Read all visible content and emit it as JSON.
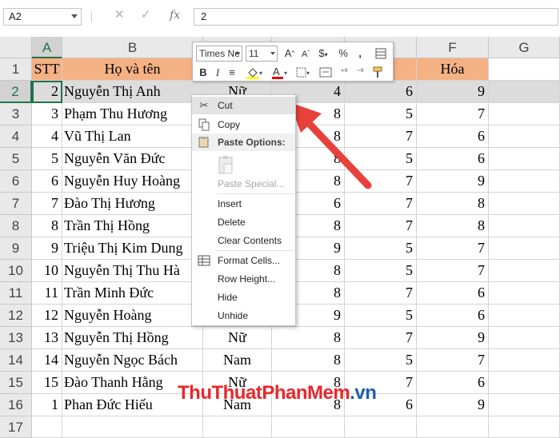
{
  "formula_bar": {
    "name_box": "A2",
    "cancel_icon": "close-icon",
    "confirm_icon": "check-icon",
    "fx_label": "fx",
    "formula_value": "2"
  },
  "columns": [
    "A",
    "B",
    "C",
    "D",
    "E",
    "F",
    "G"
  ],
  "rows": [
    "1",
    "2",
    "3",
    "4",
    "5",
    "6",
    "7",
    "8",
    "9",
    "10",
    "11",
    "12",
    "13",
    "14",
    "15",
    "16",
    "17"
  ],
  "header_row": {
    "a": "STT",
    "b": "Họ và tên",
    "f": "Hóa"
  },
  "data_rows": [
    {
      "a": "2",
      "b": "Nguyễn Thị Anh",
      "c": "Nữ",
      "d": "4",
      "e": "6",
      "f": "9"
    },
    {
      "a": "3",
      "b": "Phạm Thu Hương",
      "c": "",
      "d": "8",
      "e": "5",
      "f": "7"
    },
    {
      "a": "4",
      "b": "Vũ Thị Lan",
      "c": "",
      "d": "8",
      "e": "7",
      "f": "6"
    },
    {
      "a": "5",
      "b": "Nguyễn Văn Đức",
      "c": "",
      "d": "8",
      "e": "5",
      "f": "6"
    },
    {
      "a": "6",
      "b": "Nguyễn Huy Hoàng",
      "c": "",
      "d": "8",
      "e": "7",
      "f": "9"
    },
    {
      "a": "7",
      "b": "Đào Thị Hương",
      "c": "",
      "d": "6",
      "e": "7",
      "f": "8"
    },
    {
      "a": "8",
      "b": "Trần Thị Hồng",
      "c": "",
      "d": "8",
      "e": "7",
      "f": "8"
    },
    {
      "a": "9",
      "b": "Triệu Thị Kim Dung",
      "c": "",
      "d": "9",
      "e": "5",
      "f": "7"
    },
    {
      "a": "10",
      "b": "Nguyễn Thị Thu Hà",
      "c": "",
      "d": "8",
      "e": "5",
      "f": "7"
    },
    {
      "a": "11",
      "b": "Trần Minh Đức",
      "c": "",
      "d": "8",
      "e": "7",
      "f": "6"
    },
    {
      "a": "12",
      "b": "Nguyễn Hoàng",
      "c": "",
      "d": "9",
      "e": "5",
      "f": "6"
    },
    {
      "a": "13",
      "b": "Nguyễn Thị Hồng",
      "c": "Nữ",
      "d": "8",
      "e": "7",
      "f": "9"
    },
    {
      "a": "14",
      "b": "Nguyễn Ngọc Bách",
      "c": "Nam",
      "d": "8",
      "e": "5",
      "f": "7"
    },
    {
      "a": "15",
      "b": "Đào Thanh Hằng",
      "c": "Nữ",
      "d": "8",
      "e": "7",
      "f": "6"
    },
    {
      "a": "1",
      "b": "Phan Đức Hiếu",
      "c": "Nam",
      "d": "8",
      "e": "6",
      "f": "9"
    }
  ],
  "mini_toolbar": {
    "font_name": "Times Ne",
    "font_size": "11",
    "bold": "B",
    "italic": "I",
    "currency": "$",
    "percent": "%",
    "comma": ","
  },
  "context_menu": {
    "items": [
      {
        "label": "Cut",
        "icon": "scissors-icon"
      },
      {
        "label": "Copy",
        "icon": "copy-icon"
      },
      {
        "label": "Paste Options:",
        "icon": "paste-icon"
      },
      {
        "label": "Paste Special...",
        "icon": ""
      },
      {
        "label": "Insert",
        "icon": ""
      },
      {
        "label": "Delete",
        "icon": ""
      },
      {
        "label": "Clear Contents",
        "icon": ""
      },
      {
        "label": "Format Cells...",
        "icon": "format-cells-icon"
      },
      {
        "label": "Row Height...",
        "icon": ""
      },
      {
        "label": "Hide",
        "icon": ""
      },
      {
        "label": "Unhide",
        "icon": ""
      }
    ]
  },
  "watermark": {
    "part1": "ThuThuat",
    "part2": "PhanMem",
    "part3": ".vn"
  },
  "colors": {
    "header_fill": "#f4b183",
    "selected_row": "#dcdcdc",
    "excel_green": "#217346",
    "arrow_red": "#e8413c"
  }
}
